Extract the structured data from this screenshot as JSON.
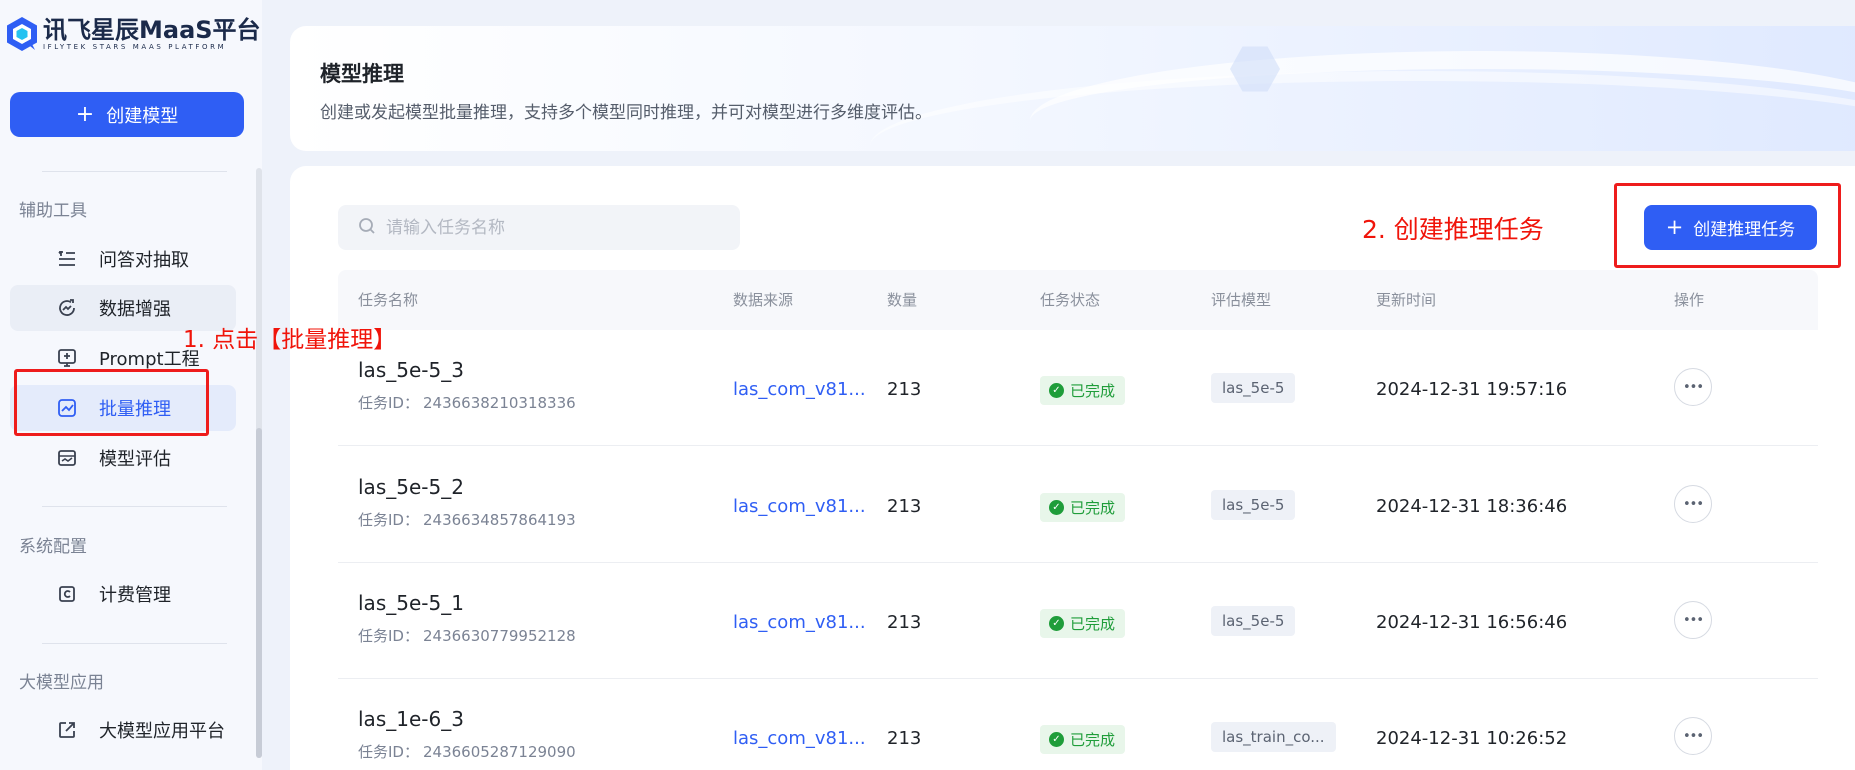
{
  "brand": {
    "title": "讯飞星辰MaaS平台",
    "subtitle": "IFLYTEK STARS MAAS PLATFORM",
    "primary_color": "#2f5ef4",
    "annotation_color": "#f0140a"
  },
  "sidebar": {
    "create_button": "创建模型",
    "sections": [
      {
        "title": "辅助工具",
        "items": [
          {
            "label": "问答对抽取",
            "icon": "list-icon"
          },
          {
            "label": "数据增强",
            "icon": "chart-refresh-icon"
          },
          {
            "label": "Prompt工程",
            "icon": "prompt-icon"
          },
          {
            "label": "批量推理",
            "icon": "line-chart-icon",
            "active": true
          },
          {
            "label": "模型评估",
            "icon": "evaluation-icon"
          }
        ]
      },
      {
        "title": "系统配置",
        "items": [
          {
            "label": "计费管理",
            "icon": "billing-icon"
          }
        ]
      },
      {
        "title": "大模型应用",
        "items": [
          {
            "label": "大模型应用平台",
            "icon": "external-link-icon"
          }
        ]
      }
    ]
  },
  "header": {
    "title": "模型推理",
    "description": "创建或发起模型批量推理，支持多个模型同时推理，并可对模型进行多维度评估。"
  },
  "toolbar": {
    "search_placeholder": "请输入任务名称",
    "new_task_button": "创建推理任务"
  },
  "annotations": {
    "step1": "1. 点击【批量推理】",
    "step2": "2. 创建推理任务"
  },
  "table": {
    "columns": [
      "任务名称",
      "数据来源",
      "数量",
      "任务状态",
      "评估模型",
      "更新时间",
      "操作"
    ],
    "id_label": "任务ID：",
    "rows": [
      {
        "name": "las_5e-5_3",
        "id": "2436638210318336",
        "source": "las_com_v81...",
        "qty": "213",
        "status": "已完成",
        "eval_model": "las_5e-5",
        "updated": "2024-12-31 19:57:16"
      },
      {
        "name": "las_5e-5_2",
        "id": "2436634857864193",
        "source": "las_com_v81...",
        "qty": "213",
        "status": "已完成",
        "eval_model": "las_5e-5",
        "updated": "2024-12-31 18:36:46"
      },
      {
        "name": "las_5e-5_1",
        "id": "2436630779952128",
        "source": "las_com_v81...",
        "qty": "213",
        "status": "已完成",
        "eval_model": "las_5e-5",
        "updated": "2024-12-31 16:56:46"
      },
      {
        "name": "las_1e-6_3",
        "id": "2436605287129090",
        "source": "las_com_v81...",
        "qty": "213",
        "status": "已完成",
        "eval_model": "las_train_co...",
        "updated": "2024-12-31 10:26:52"
      }
    ]
  }
}
